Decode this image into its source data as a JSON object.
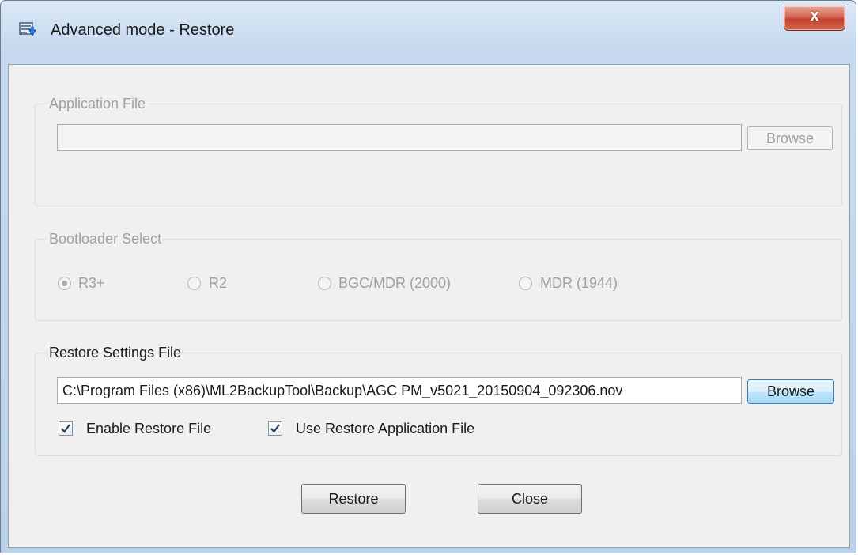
{
  "window": {
    "title": "Advanced mode - Restore",
    "close_glyph": "x"
  },
  "application_file": {
    "legend": "Application File",
    "path_value": "",
    "browse_label": "Browse",
    "enabled": false
  },
  "bootloader": {
    "legend": "Bootloader Select",
    "enabled": false,
    "options": [
      {
        "label": "R3+",
        "checked": true
      },
      {
        "label": "R2",
        "checked": false
      },
      {
        "label": "BGC/MDR (2000)",
        "checked": false
      },
      {
        "label": "MDR (1944)",
        "checked": false
      }
    ]
  },
  "restore_settings": {
    "legend": "Restore Settings File",
    "path_value": "C:\\Program Files (x86)\\ML2BackupTool\\Backup\\AGC PM_v5021_20150904_092306.nov",
    "browse_label": "Browse",
    "enable_restore_label": "Enable Restore File",
    "enable_restore_checked": true,
    "use_restore_app_label": "Use Restore Application File",
    "use_restore_app_checked": true
  },
  "actions": {
    "restore_label": "Restore",
    "close_label": "Close"
  },
  "colors": {
    "disabled_text": "#a0a0a0",
    "focus_border": "#3c7fb1",
    "close_red": "#c0402c"
  }
}
